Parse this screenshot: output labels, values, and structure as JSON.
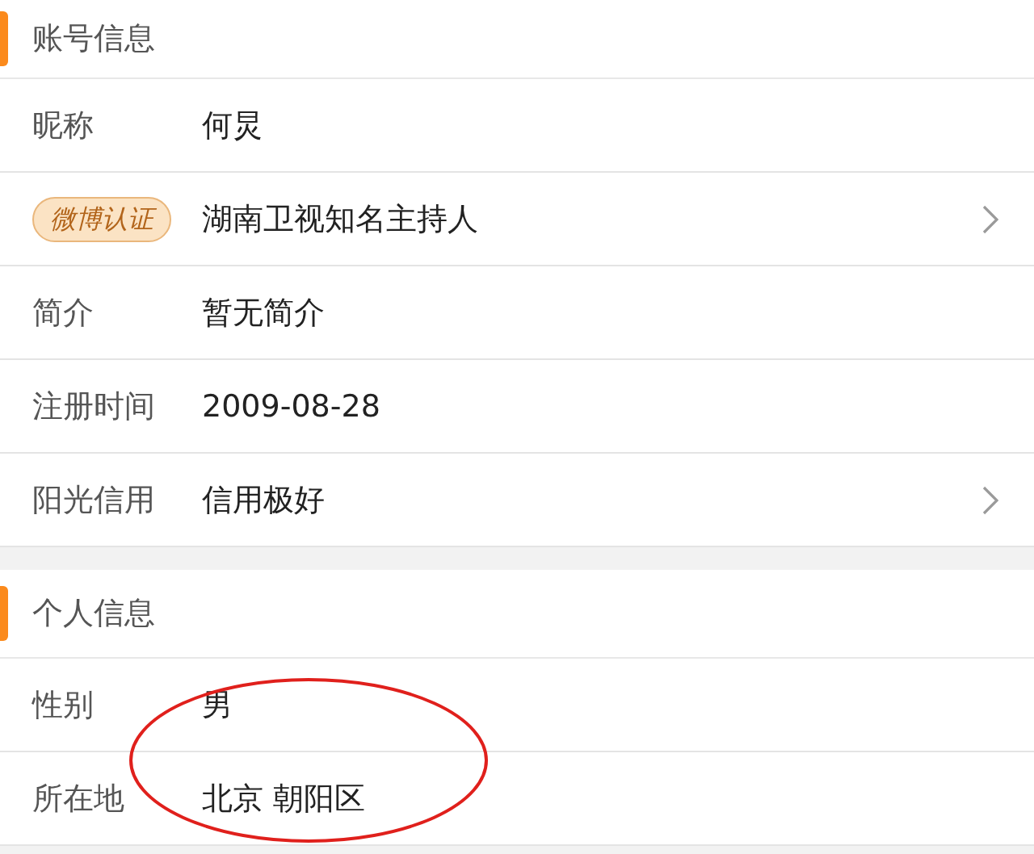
{
  "sections": [
    {
      "title": "账号信息",
      "rows": [
        {
          "kind": "plain",
          "label": "昵称",
          "value": "何炅",
          "chevron": false
        },
        {
          "kind": "badge",
          "label": "微博认证",
          "value": "湖南卫视知名主持人",
          "chevron": true
        },
        {
          "kind": "plain",
          "label": "简介",
          "value": "暂无简介",
          "chevron": false
        },
        {
          "kind": "plain",
          "label": "注册时间",
          "value": "2009-08-28",
          "chevron": false
        },
        {
          "kind": "plain",
          "label": "阳光信用",
          "value": "信用极好",
          "chevron": true
        }
      ]
    },
    {
      "title": "个人信息",
      "rows": [
        {
          "kind": "plain",
          "label": "性别",
          "value": "男",
          "chevron": false
        },
        {
          "kind": "plain",
          "label": "所在地",
          "value": "北京 朝阳区",
          "chevron": false
        }
      ]
    }
  ],
  "annotation": {
    "kind": "ellipse"
  }
}
